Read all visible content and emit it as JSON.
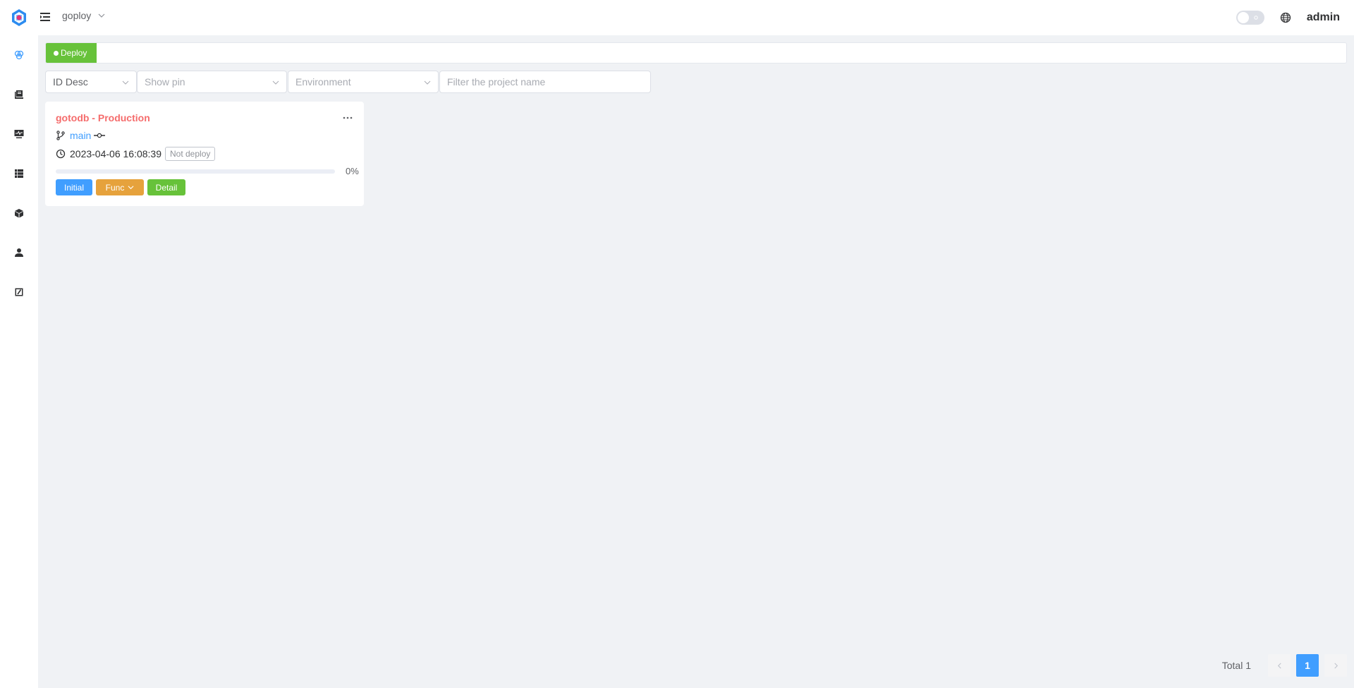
{
  "navbar": {
    "namespace": "goploy",
    "username": "admin",
    "icons": {
      "logo": "goploy-logo-icon",
      "menu_toggle": "hamburger-icon",
      "theme": "theme-switch-sun-icon",
      "language": "globe-icon"
    }
  },
  "sidebar": {
    "items": [
      {
        "name": "deploy",
        "icon": "atom-icon",
        "active": true
      },
      {
        "name": "project",
        "icon": "book-icon",
        "active": false
      },
      {
        "name": "monitor",
        "icon": "monitor-pulse-icon",
        "active": false
      },
      {
        "name": "server",
        "icon": "server-list-icon",
        "active": false
      },
      {
        "name": "cron",
        "icon": "cube-icon",
        "active": false
      },
      {
        "name": "member",
        "icon": "user-icon",
        "active": false
      },
      {
        "name": "log",
        "icon": "edit-log-icon",
        "active": false
      }
    ]
  },
  "tags": [
    {
      "label": "Deploy",
      "active": true
    }
  ],
  "filters": {
    "sort": {
      "value": "ID Desc"
    },
    "pin": {
      "placeholder": "Show pin"
    },
    "environment": {
      "placeholder": "Environment"
    },
    "project_name": {
      "placeholder": "Filter the project name",
      "value": ""
    }
  },
  "projects": [
    {
      "title": "gotodb - Production",
      "branch": "main",
      "time": "2023-04-06 16:08:39",
      "status": "Not deploy",
      "progress_percent": 0,
      "progress_text": "0%",
      "buttons": {
        "initial": "Initial",
        "func": "Func",
        "detail": "Detail"
      }
    }
  ],
  "pagination": {
    "total_text": "Total 1",
    "current_page": "1"
  },
  "colors": {
    "primary": "#409eff",
    "success": "#67c23a",
    "warning": "#e6a23c",
    "danger": "#f56c6c",
    "background": "#f0f2f5"
  }
}
